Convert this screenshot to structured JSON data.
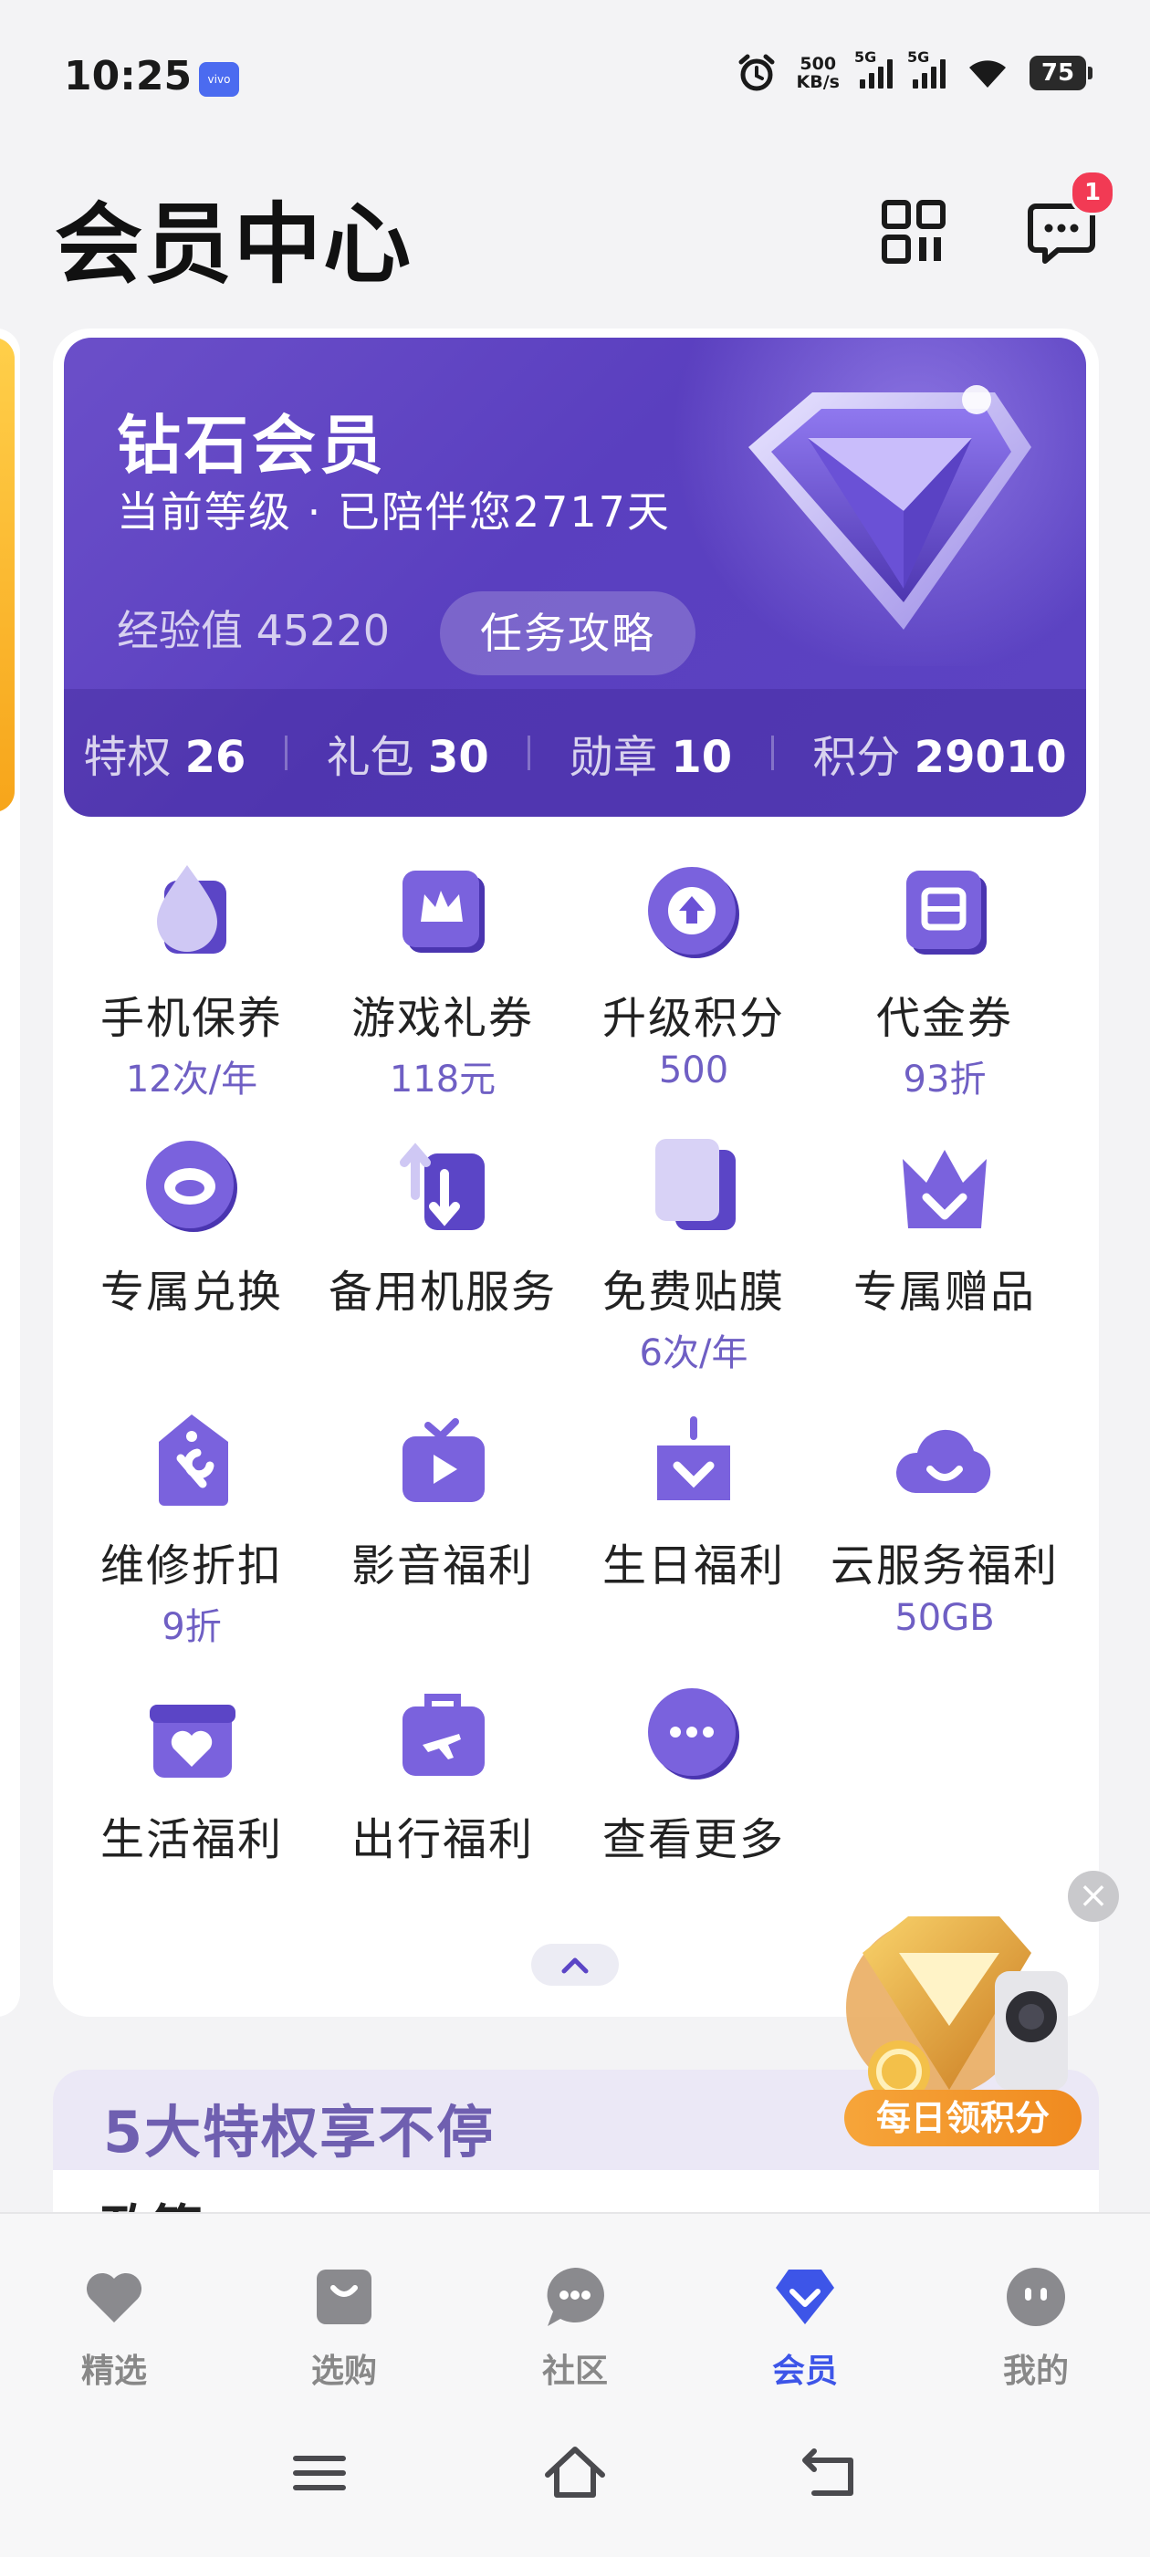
{
  "status_bar": {
    "time": "10:25",
    "vendor_badge": "vivo",
    "net_speed_value": "500",
    "net_speed_unit": "KB/s",
    "signal_1_tag": "5G",
    "signal_2_tag": "5G",
    "battery": "75"
  },
  "header": {
    "title": "会员中心",
    "message_badge": "1"
  },
  "hero": {
    "level_name": "钻石会员",
    "level_subtitle": "当前等级 · 已陪伴您2717天",
    "exp_label": "经验值",
    "exp_value": "45220",
    "task_button": "任务攻略",
    "stats": [
      {
        "label": "特权",
        "value": "26"
      },
      {
        "label": "礼包",
        "value": "30"
      },
      {
        "label": "勋章",
        "value": "10"
      },
      {
        "label": "积分",
        "value": "29010"
      }
    ]
  },
  "benefits": [
    {
      "name": "手机保养",
      "sub": "12次/年",
      "icon": "droplet-icon"
    },
    {
      "name": "游戏礼券",
      "sub": "118元",
      "icon": "crown-ticket-icon"
    },
    {
      "name": "升级积分",
      "sub": "500",
      "icon": "arrow-up-coin-icon"
    },
    {
      "name": "代金券",
      "sub": "93折",
      "icon": "voucher-icon"
    },
    {
      "name": "专属兑换",
      "sub": "",
      "icon": "exchange-coin-icon"
    },
    {
      "name": "备用机服务",
      "sub": "",
      "icon": "swap-phone-icon"
    },
    {
      "name": "免费贴膜",
      "sub": "6次/年",
      "icon": "screen-film-icon"
    },
    {
      "name": "专属赠品",
      "sub": "",
      "icon": "crown-gift-icon"
    },
    {
      "name": "维修折扣",
      "sub": "9折",
      "icon": "wrench-tag-icon"
    },
    {
      "name": "影音福利",
      "sub": "",
      "icon": "play-tv-icon"
    },
    {
      "name": "生日福利",
      "sub": "",
      "icon": "birthday-cake-icon"
    },
    {
      "name": "云服务福利",
      "sub": "50GB",
      "icon": "cloud-icon"
    },
    {
      "name": "生活福利",
      "sub": "",
      "icon": "heart-gift-icon"
    },
    {
      "name": "出行福利",
      "sub": "",
      "icon": "plane-bag-icon"
    },
    {
      "name": "查看更多",
      "sub": "",
      "icon": "more-dots-icon"
    }
  ],
  "promo": {
    "label": "每日领积分",
    "close": "×"
  },
  "privileges": {
    "title": "5大特权享不停",
    "first_item_peek": "政策"
  },
  "bottom_nav": {
    "items": [
      {
        "label": "精选",
        "icon": "heart-icon",
        "active": false
      },
      {
        "label": "选购",
        "icon": "shopping-bag-icon",
        "active": false
      },
      {
        "label": "社区",
        "icon": "chat-bubble-icon",
        "active": false
      },
      {
        "label": "会员",
        "icon": "diamond-icon",
        "active": true
      },
      {
        "label": "我的",
        "icon": "profile-face-icon",
        "active": false
      }
    ]
  },
  "colors": {
    "accent_blue": "#3d55e8",
    "hero_purple": "#5a3fbf",
    "benefit_sub": "#6f5fc4",
    "badge_red": "#f23a54",
    "promo_orange": "#f08a1f"
  }
}
